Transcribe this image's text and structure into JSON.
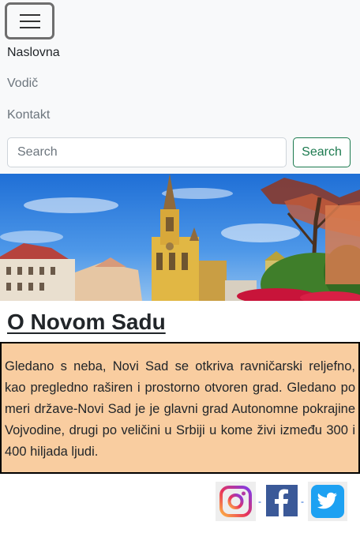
{
  "nav": {
    "items": [
      {
        "label": "Naslovna",
        "active": true
      },
      {
        "label": "Vodič",
        "active": false
      },
      {
        "label": "Kontakt",
        "active": false
      }
    ],
    "search": {
      "placeholder": "Search",
      "button_label": "Search"
    }
  },
  "hero": {
    "image": "novi-sad-cathedral-photo"
  },
  "main": {
    "heading": "O Novom Sadu",
    "paragraph": "Gledano s neba, Novi Sad se otkriva ravničarski reljefno, kao pregledno raširen i prostorno otvoren grad. Gledano po meri države-Novi Sad je je glavni grad Autonomne pokrajine Vojvodine, drugi po veličini u Srbiji u kome živi između 300 i 400 hiljada ljudi."
  },
  "social": {
    "icons": [
      "instagram-icon",
      "facebook-icon",
      "twitter-icon"
    ],
    "separator": "-"
  },
  "colors": {
    "navbar_bg": "#f8f9fa",
    "text_box_bg": "#f9cda0",
    "search_button": "#1c7a4f",
    "facebook": "#3b5998",
    "twitter": "#1da1f2"
  }
}
